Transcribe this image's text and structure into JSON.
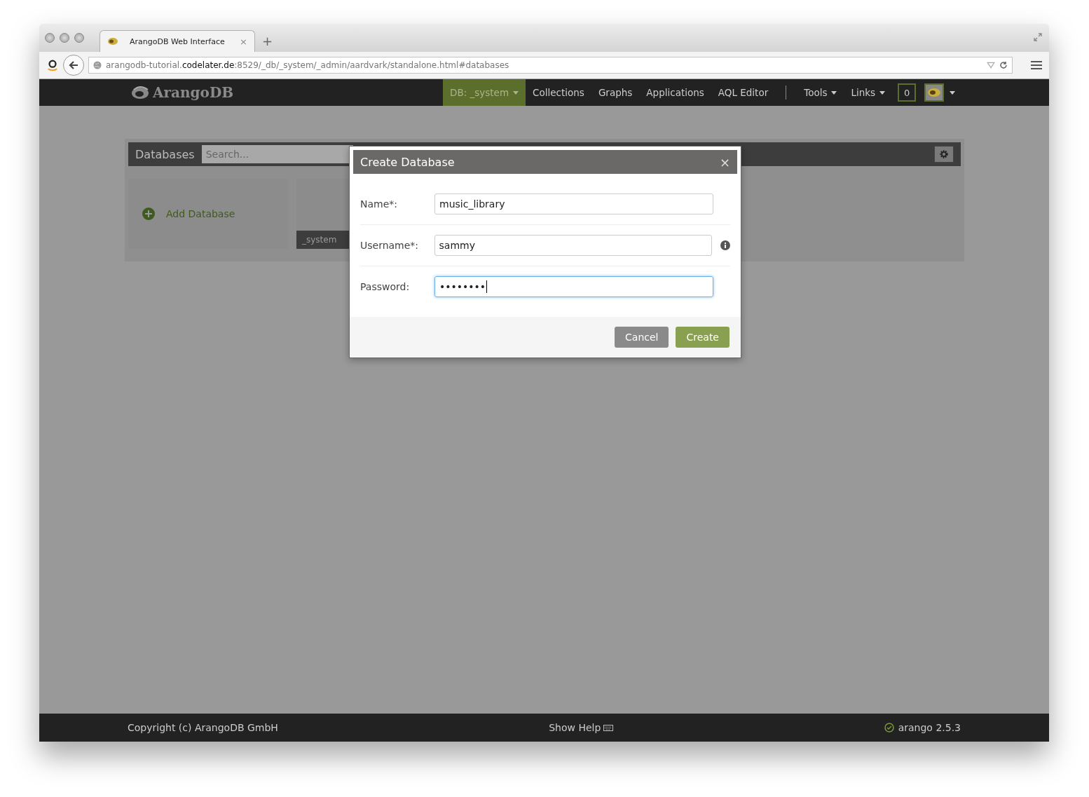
{
  "browser": {
    "tab": {
      "title": "ArangoDB Web Interface",
      "close": "×"
    },
    "new_tab": "+",
    "url": {
      "prefix": "arangodb-tutorial.",
      "domain": "codelater.de",
      "suffix": ":8529/_db/_system/_admin/aardvark/standalone.html#databases"
    }
  },
  "navbar": {
    "logo": "ArangoDB",
    "items": [
      {
        "label": "DB: _system",
        "selected": true,
        "dropdown": true
      },
      {
        "label": "Collections",
        "selected": false,
        "dropdown": false
      },
      {
        "label": "Graphs",
        "selected": false,
        "dropdown": false
      },
      {
        "label": "Applications",
        "selected": false,
        "dropdown": false
      },
      {
        "label": "AQL Editor",
        "selected": false,
        "dropdown": false
      },
      {
        "label": "Tools",
        "selected": false,
        "dropdown": true
      },
      {
        "label": "Links",
        "selected": false,
        "dropdown": true
      }
    ],
    "notifications": "0"
  },
  "page": {
    "title": "Databases",
    "search": {
      "placeholder": "Search..."
    },
    "tiles": [
      {
        "kind": "add",
        "label": "Add Database"
      },
      {
        "kind": "database",
        "label": "_system"
      }
    ]
  },
  "dialog": {
    "title": "Create Database",
    "close": "×",
    "fields": [
      {
        "label": "Name*:",
        "value": "music_library",
        "info": false,
        "focused": false
      },
      {
        "label": "Username*:",
        "value": "sammy",
        "info": true,
        "focused": false
      },
      {
        "label": "Password:",
        "value": "••••••••",
        "info": false,
        "focused": true
      }
    ],
    "buttons": [
      {
        "label": "Cancel",
        "kind": "secondary"
      },
      {
        "label": "Create",
        "kind": "primary"
      }
    ]
  },
  "footer": {
    "copyright": "Copyright (c) ArangoDB GmbH",
    "help": "Show Help",
    "version": "arango 2.5.3"
  }
}
